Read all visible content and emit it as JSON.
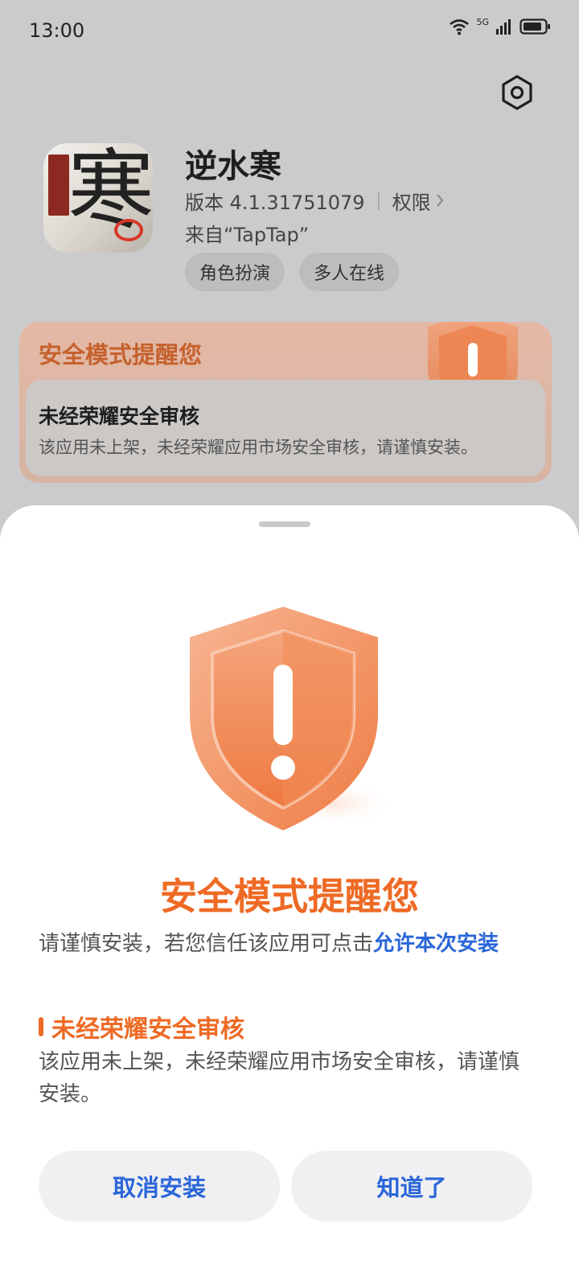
{
  "status_bar": {
    "time": "13:00",
    "network": "5G",
    "icons": [
      "wifi-icon",
      "signal-icon",
      "battery-icon"
    ]
  },
  "header": {
    "settings_icon": "gear-icon"
  },
  "app": {
    "name": "逆水寒",
    "version": "版本 4.1.31751079",
    "permissions_label": "权限",
    "source": "来自“TapTap”",
    "tags": [
      "角色扮演",
      "多人在线"
    ]
  },
  "background_card": {
    "title": "安全模式提醒您",
    "inner_title": "未经荣耀安全审核",
    "inner_desc": "该应用未上架，未经荣耀应用市场安全审核，请谨慎安装。"
  },
  "sheet": {
    "title": "安全模式提醒您",
    "subtitle_prefix": "请谨慎安装，若您信任该应用可点击",
    "subtitle_link": "允许本次安装",
    "section_title": "未经荣耀安全审核",
    "section_desc": "该应用未上架，未经荣耀应用市场安全审核，请谨慎安装。",
    "cancel_label": "取消安装",
    "ok_label": "知道了"
  },
  "colors": {
    "accent_orange": "#ee6a25",
    "link_blue": "#2a66d9"
  }
}
